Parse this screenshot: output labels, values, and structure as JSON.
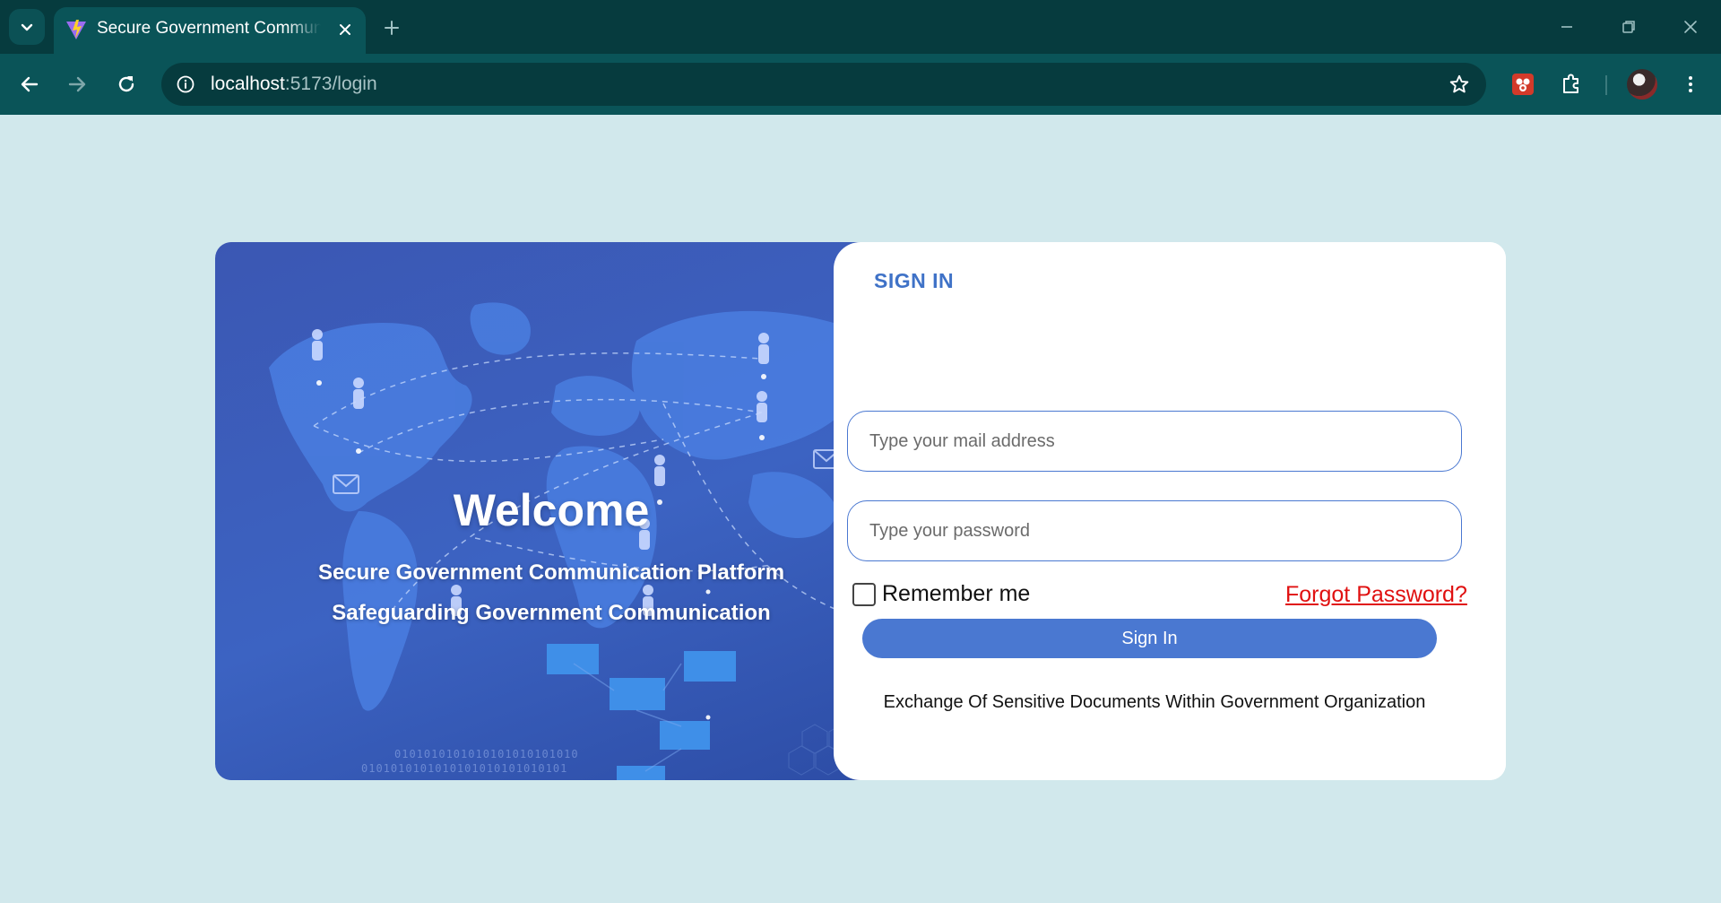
{
  "browser": {
    "tab": {
      "title": "Secure Government Communication Platform"
    },
    "url": {
      "host": "localhost",
      "path": ":5173/login"
    },
    "icons": {
      "tab_menu": "chevron-down-icon",
      "tab_close": "close-icon",
      "new_tab": "plus-icon",
      "back": "arrow-left-icon",
      "forward": "arrow-right-icon",
      "reload": "reload-icon",
      "site_info": "info-icon",
      "bookmark": "star-icon",
      "extension": "puzzle-icon",
      "menu": "more-vert-icon"
    },
    "colors": {
      "frame": "#063b3e",
      "toolbar": "#0a5458"
    }
  },
  "hero": {
    "welcome": "Welcome",
    "subtitle_1": "Secure Government Communication Platform",
    "subtitle_2": "Safeguarding Government Communication",
    "binary_1": "0101010101010101010101010",
    "binary_2": "0101010101010101010101010101"
  },
  "login": {
    "title": "SIGN IN",
    "email_placeholder": "Type your mail address",
    "password_placeholder": "Type your password",
    "remember_label": "Remember me",
    "forgot_label": "Forgot Password?",
    "signin_button": "Sign In",
    "footer": "Exchange Of Sensitive Documents Within Government Organization"
  },
  "colors": {
    "page_bg": "#d1e8ec",
    "accent": "#4a78d1",
    "title": "#3f72c7",
    "forgot": "#e01010",
    "hero_bg": "#3b57b3"
  }
}
